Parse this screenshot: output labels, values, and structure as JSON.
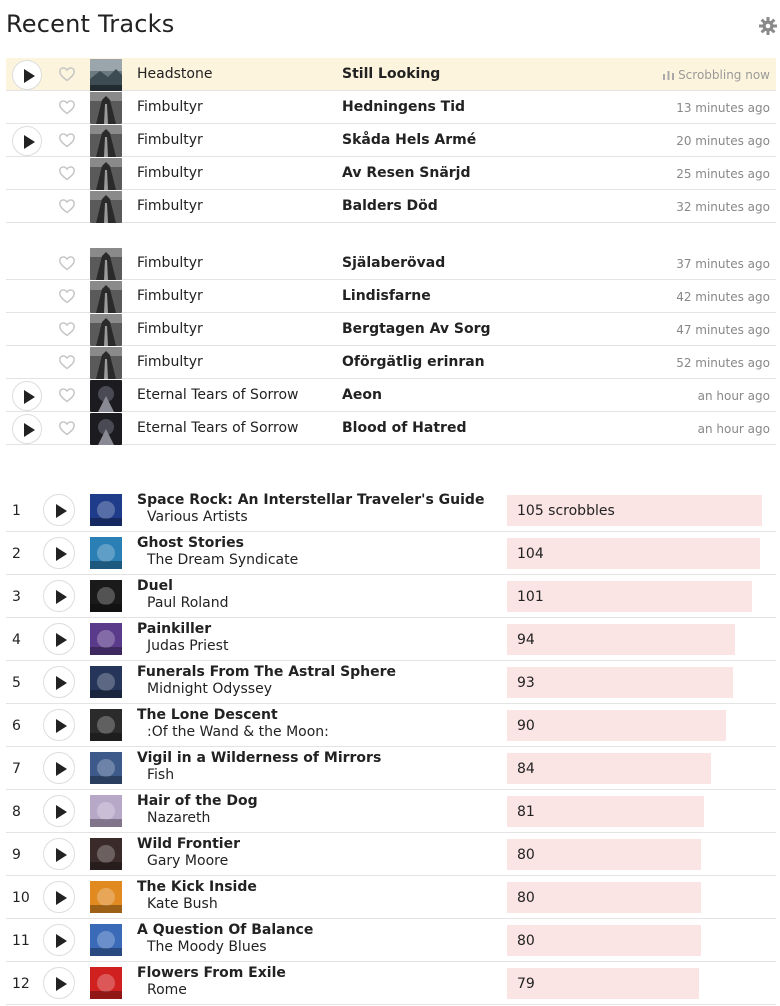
{
  "header": {
    "title": "Recent Tracks",
    "settings_icon": "gear-icon"
  },
  "recent_tracks": [
    {
      "artist": "Headstone",
      "track": "Still Looking",
      "time": "Scrobbling now",
      "now_playing": true,
      "playable": true
    },
    {
      "artist": "Fimbultyr",
      "track": "Hedningens Tid",
      "time": "13 minutes ago",
      "playable": false
    },
    {
      "artist": "Fimbultyr",
      "track": "Skåda Hels Armé",
      "time": "20 minutes ago",
      "playable": true
    },
    {
      "artist": "Fimbultyr",
      "track": "Av Resen Snärjd",
      "time": "25 minutes ago",
      "playable": false
    },
    {
      "artist": "Fimbultyr",
      "track": "Balders Död",
      "time": "32 minutes ago",
      "playable": false
    },
    {
      "artist": "Fimbultyr",
      "track": "Själaberövad",
      "time": "37 minutes ago",
      "playable": false,
      "group_start": true
    },
    {
      "artist": "Fimbultyr",
      "track": "Lindisfarne",
      "time": "42 minutes ago",
      "playable": false
    },
    {
      "artist": "Fimbultyr",
      "track": "Bergtagen Av Sorg",
      "time": "47 minutes ago",
      "playable": false
    },
    {
      "artist": "Fimbultyr",
      "track": "Oförgätlig erinran",
      "time": "52 minutes ago",
      "playable": false
    },
    {
      "artist": "Eternal Tears of Sorrow",
      "track": "Aeon",
      "time": "an hour ago",
      "playable": true
    },
    {
      "artist": "Eternal Tears of Sorrow",
      "track": "Blood of Hatred",
      "time": "an hour ago",
      "playable": true
    }
  ],
  "top_tracks": {
    "max_count": 105,
    "items": [
      {
        "rank": "1",
        "title": "Space Rock: An Interstellar Traveler's Guide",
        "artist": "Various Artists",
        "count": 105,
        "count_label": "105 scrobbles",
        "cover": "#1f3c8a"
      },
      {
        "rank": "2",
        "title": "Ghost Stories",
        "artist": "The Dream Syndicate",
        "count": 104,
        "count_label": "104",
        "cover": "#2a7fb5"
      },
      {
        "rank": "3",
        "title": "Duel",
        "artist": "Paul Roland",
        "count": 101,
        "count_label": "101",
        "cover": "#1a1a1a"
      },
      {
        "rank": "4",
        "title": "Painkiller",
        "artist": "Judas Priest",
        "count": 94,
        "count_label": "94",
        "cover": "#5a3a8a"
      },
      {
        "rank": "5",
        "title": "Funerals From The Astral Sphere",
        "artist": "Midnight Odyssey",
        "count": 93,
        "count_label": "93",
        "cover": "#26355a"
      },
      {
        "rank": "6",
        "title": "The Lone Descent",
        "artist": ":Of the Wand & the Moon:",
        "count": 90,
        "count_label": "90",
        "cover": "#2b2b2b"
      },
      {
        "rank": "7",
        "title": "Vigil in a Wilderness of Mirrors",
        "artist": "Fish",
        "count": 84,
        "count_label": "84",
        "cover": "#3d5a8a"
      },
      {
        "rank": "8",
        "title": "Hair of the Dog",
        "artist": "Nazareth",
        "count": 81,
        "count_label": "81",
        "cover": "#b8a8c8"
      },
      {
        "rank": "9",
        "title": "Wild Frontier",
        "artist": "Gary Moore",
        "count": 80,
        "count_label": "80",
        "cover": "#3a2a2a"
      },
      {
        "rank": "10",
        "title": "The Kick Inside",
        "artist": "Kate Bush",
        "count": 80,
        "count_label": "80",
        "cover": "#e08a20"
      },
      {
        "rank": "11",
        "title": "A Question Of Balance",
        "artist": "The Moody Blues",
        "count": 80,
        "count_label": "80",
        "cover": "#3a6ab8"
      },
      {
        "rank": "12",
        "title": "Flowers From Exile",
        "artist": "Rome",
        "count": 79,
        "count_label": "79",
        "cover": "#d02020"
      }
    ]
  },
  "colors": {
    "now_playing_bg": "#fcf4dc",
    "bar_bg": "#fbe4e4",
    "muted_text": "#888888"
  }
}
